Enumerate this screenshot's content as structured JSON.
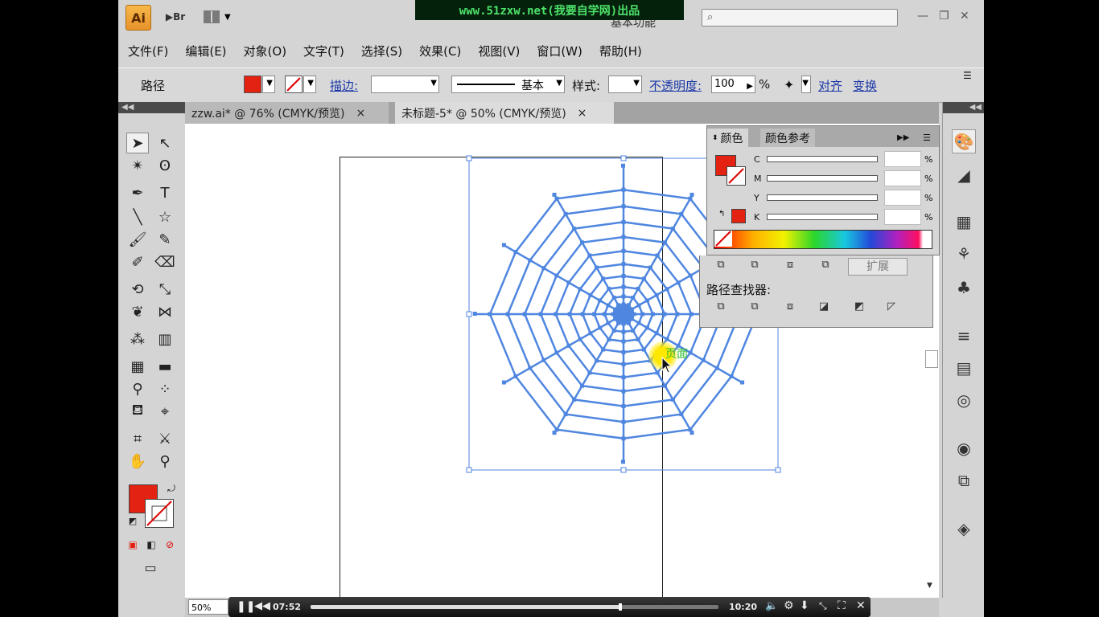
{
  "app": {
    "logo": "Ai",
    "bridge": "Br",
    "watermark": "www.51zxw.net(我要自学网)出品",
    "workspace": "基本功能"
  },
  "menus": [
    "文件(F)",
    "编辑(E)",
    "对象(O)",
    "文字(T)",
    "选择(S)",
    "效果(C)",
    "视图(V)",
    "窗口(W)",
    "帮助(H)"
  ],
  "control": {
    "selection": "路径",
    "stroke_label": "描边:",
    "stroke_style": "基本",
    "style_label": "样式:",
    "opacity_label": "不透明度:",
    "opacity_value": "100",
    "percent": "%",
    "align": "对齐",
    "transform": "变换",
    "fill_color": "#e32212"
  },
  "tabs": [
    {
      "label": "zzw.ai* @ 76% (CMYK/预览)",
      "close": "×",
      "active": false
    },
    {
      "label": "未标题-5* @ 50% (CMYK/预览)",
      "close": "×",
      "active": true
    }
  ],
  "color_panel": {
    "tab_color": "颜色",
    "tab_guide": "颜色参考",
    "channels": [
      "C",
      "M",
      "Y",
      "K"
    ],
    "percent": "%"
  },
  "pathfinder": {
    "expand": "扩展",
    "title": "路径查找器:"
  },
  "canvas": {
    "hover_tip": "页面",
    "zoom": "50%",
    "web_color": "#4f86e0"
  },
  "player": {
    "elapsed": "07:52",
    "total": "10:20",
    "progress": 0.76
  }
}
